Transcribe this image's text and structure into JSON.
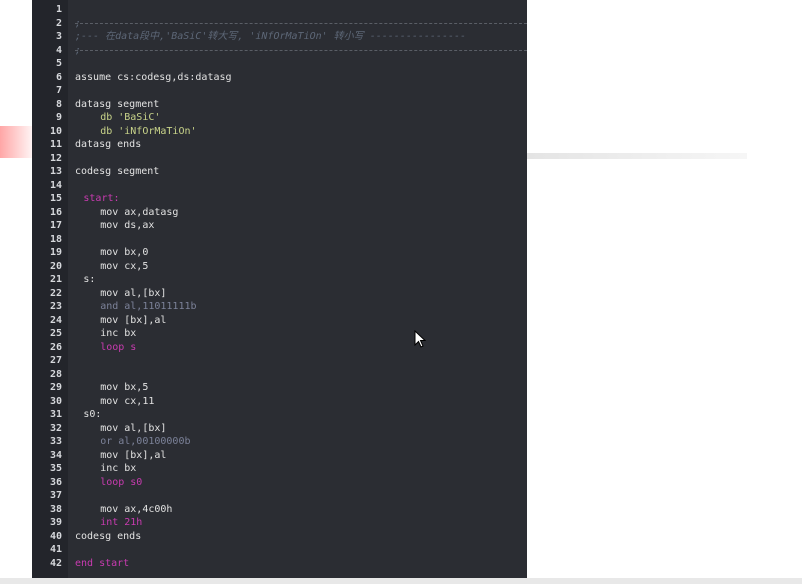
{
  "editor": {
    "lines": [
      {
        "n": "1",
        "code": ""
      },
      {
        "n": "2",
        "code": ";"
      },
      {
        "n": "3",
        "code": ";--- 在data段中,'BaSiC'转大写, 'iNfOrMaTiOn' 转小写 ----------------"
      },
      {
        "n": "4",
        "code": ";"
      },
      {
        "n": "5",
        "code": ""
      },
      {
        "n": "6",
        "code": "assume cs:codesg,ds:datasg"
      },
      {
        "n": "7",
        "code": ""
      },
      {
        "n": "8",
        "code": "datasg segment"
      },
      {
        "n": "9",
        "code": "db 'BaSiC'"
      },
      {
        "n": "10",
        "code": "db 'iNfOrMaTiOn'"
      },
      {
        "n": "11",
        "code": "datasg ends"
      },
      {
        "n": "12",
        "code": ""
      },
      {
        "n": "13",
        "code": "codesg segment"
      },
      {
        "n": "14",
        "code": ""
      },
      {
        "n": "15",
        "code": "start:"
      },
      {
        "n": "16",
        "code": "mov ax,datasg"
      },
      {
        "n": "17",
        "code": "mov ds,ax"
      },
      {
        "n": "18",
        "code": ""
      },
      {
        "n": "19",
        "code": "mov bx,0"
      },
      {
        "n": "20",
        "code": "mov cx,5"
      },
      {
        "n": "21",
        "code": "s:"
      },
      {
        "n": "22",
        "code": "mov al,[bx]"
      },
      {
        "n": "23",
        "code": "and al,11011111b"
      },
      {
        "n": "24",
        "code": "mov [bx],al"
      },
      {
        "n": "25",
        "code": "inc bx"
      },
      {
        "n": "26",
        "code": "loop s"
      },
      {
        "n": "27",
        "code": ""
      },
      {
        "n": "28",
        "code": ""
      },
      {
        "n": "29",
        "code": "mov bx,5"
      },
      {
        "n": "30",
        "code": "mov cx,11"
      },
      {
        "n": "31",
        "code": "s0:"
      },
      {
        "n": "32",
        "code": "mov al,[bx]"
      },
      {
        "n": "33",
        "code": "or al,00100000b"
      },
      {
        "n": "34",
        "code": "mov [bx],al"
      },
      {
        "n": "35",
        "code": "inc bx"
      },
      {
        "n": "36",
        "code": "loop s0"
      },
      {
        "n": "37",
        "code": ""
      },
      {
        "n": "38",
        "code": "mov ax,4c00h"
      },
      {
        "n": "39",
        "code": "int 21h"
      },
      {
        "n": "40",
        "code": "codesg ends"
      },
      {
        "n": "41",
        "code": ""
      },
      {
        "n": "42",
        "code": "end start"
      }
    ]
  },
  "colors": {
    "editor_bg": "#2b2d33",
    "comment": "#5d6777",
    "keyword": "#c83bb0",
    "string": "#c9d48a"
  }
}
